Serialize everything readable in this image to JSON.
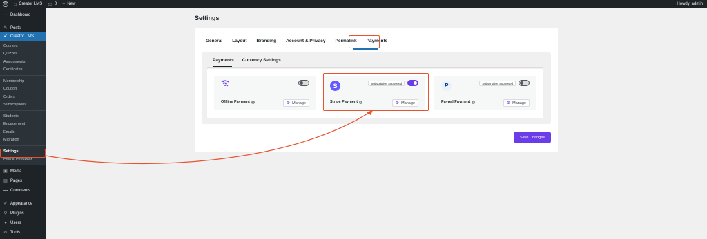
{
  "admin_bar": {
    "site_name": "Creator LMS",
    "comments_count": "0",
    "new_label": "New",
    "howdy": "Howdy, admin"
  },
  "sidebar": {
    "top_items": [
      {
        "label": "Dashboard",
        "icon": "dashboard-icon"
      },
      {
        "label": "Posts",
        "icon": "pin-icon"
      },
      {
        "label": "Creator LMS",
        "icon": "creator-lms-icon"
      }
    ],
    "submenu": {
      "group1": [
        "Courses",
        "Quizzes",
        "Assignments",
        "Certificates"
      ],
      "group2": [
        "Membership",
        "Coupon",
        "Orders",
        "Subscriptions"
      ],
      "group3": [
        "Students",
        "Engagement",
        "Emails",
        "Migration"
      ],
      "group4": [
        "Settings",
        "Help & Feedback"
      ]
    },
    "bottom_items": [
      {
        "label": "Media",
        "icon": "media-icon"
      },
      {
        "label": "Pages",
        "icon": "pages-icon"
      },
      {
        "label": "Comments",
        "icon": "comments-icon"
      },
      {
        "label": "Appearance",
        "icon": "brush-icon"
      },
      {
        "label": "Plugins",
        "icon": "plugin-icon"
      },
      {
        "label": "Users",
        "icon": "users-icon"
      },
      {
        "label": "Tools",
        "icon": "wrench-icon"
      }
    ]
  },
  "page": {
    "title": "Settings",
    "tabs": [
      "General",
      "Layout",
      "Branding",
      "Account & Privacy",
      "Permalink",
      "Payments"
    ],
    "active_tab": "Payments",
    "subtabs": [
      "Payments",
      "Currency Settings"
    ],
    "active_subtab": "Payments",
    "save_label": "Save Changes"
  },
  "gateways": [
    {
      "name": "Offline Payment",
      "enabled": false,
      "badge": "",
      "manage_label": "Manage",
      "logo": "wifi-icon"
    },
    {
      "name": "Stripe Payment",
      "enabled": true,
      "badge": "Subscription Supported",
      "manage_label": "Manage",
      "logo": "stripe-logo"
    },
    {
      "name": "Paypal Payment",
      "enabled": false,
      "badge": "Subscription Supported",
      "manage_label": "Manage",
      "logo": "paypal-logo"
    }
  ],
  "colors": {
    "accent": "#6a3de8",
    "highlight": "#e8522e",
    "admin_blue": "#2271b1"
  }
}
